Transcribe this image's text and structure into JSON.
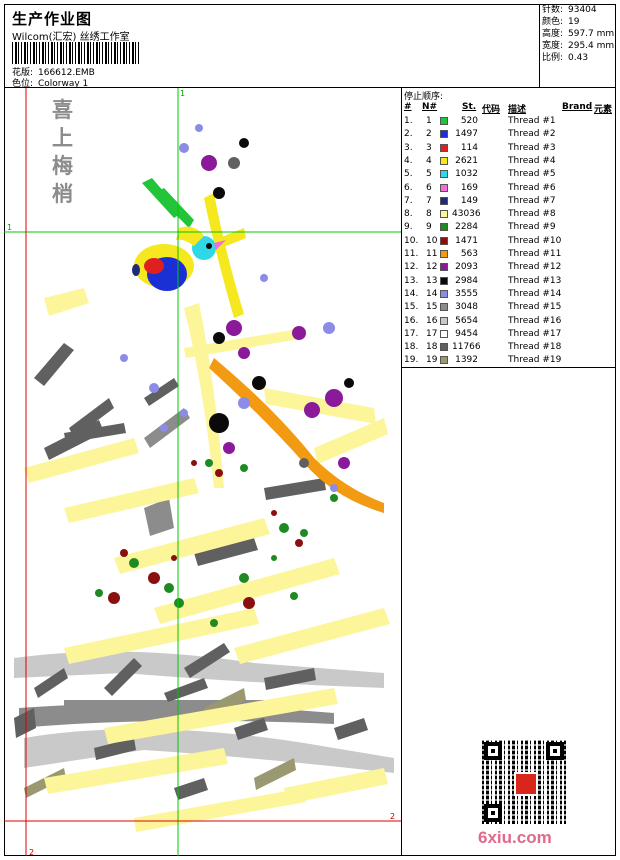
{
  "header": {
    "title": "生产作业图",
    "company": "Wilcom(汇宏) 丝绣工作室",
    "design_label": "花版:",
    "design_file": "166612.EMB",
    "colorway_label": "色位:",
    "colorway": "Colorway 1"
  },
  "stats": {
    "stitches_label": "针数:",
    "stitches": "93404",
    "colors_label": "颜色:",
    "colors": "19",
    "height_label": "高度:",
    "height": "597.7 mm",
    "width_label": "宽度:",
    "width": "295.4 mm",
    "scale_label": "比例:",
    "scale": "0.43"
  },
  "design": {
    "calligraphy": "喜上梅梢",
    "guide_label_top": "1",
    "guide_label_left": "1",
    "guide_label_right": "2",
    "guide_label_bottom": "2"
  },
  "legend": {
    "title": "停止顺序:",
    "headers": {
      "num": "#",
      "n": "N#",
      "st": "St.",
      "code": "代码",
      "desc": "描述",
      "brand": "Brand",
      "element": "元素"
    },
    "rows": [
      {
        "num": "1.",
        "n": "1",
        "st": "520",
        "color": "#22c43a",
        "desc": "Thread #1"
      },
      {
        "num": "2.",
        "n": "2",
        "st": "1497",
        "color": "#1a2fd4",
        "desc": "Thread #2"
      },
      {
        "num": "3.",
        "n": "3",
        "st": "114",
        "color": "#e02020",
        "desc": "Thread #3"
      },
      {
        "num": "4.",
        "n": "4",
        "st": "2621",
        "color": "#f5e81e",
        "desc": "Thread #4"
      },
      {
        "num": "5.",
        "n": "5",
        "st": "1032",
        "color": "#2ed8e6",
        "desc": "Thread #5"
      },
      {
        "num": "6.",
        "n": "6",
        "st": "169",
        "color": "#f070d8",
        "desc": "Thread #6"
      },
      {
        "num": "7.",
        "n": "7",
        "st": "149",
        "color": "#1e2a7a",
        "desc": "Thread #7"
      },
      {
        "num": "8.",
        "n": "8",
        "st": "43036",
        "color": "#fdf59a",
        "desc": "Thread #8"
      },
      {
        "num": "9.",
        "n": "9",
        "st": "2284",
        "color": "#1f8a22",
        "desc": "Thread #9"
      },
      {
        "num": "10.",
        "n": "10",
        "st": "1471",
        "color": "#8a0f0f",
        "desc": "Thread #10"
      },
      {
        "num": "11.",
        "n": "11",
        "st": "563",
        "color": "#f29a12",
        "desc": "Thread #11"
      },
      {
        "num": "12.",
        "n": "12",
        "st": "2093",
        "color": "#8a1a9a",
        "desc": "Thread #12"
      },
      {
        "num": "13.",
        "n": "13",
        "st": "2984",
        "color": "#0a0a0a",
        "desc": "Thread #13"
      },
      {
        "num": "14.",
        "n": "14",
        "st": "3555",
        "color": "#8c8ce6",
        "desc": "Thread #14"
      },
      {
        "num": "15.",
        "n": "15",
        "st": "3048",
        "color": "#8c8c8c",
        "desc": "Thread #15"
      },
      {
        "num": "16.",
        "n": "16",
        "st": "5654",
        "color": "#c9c9c9",
        "desc": "Thread #16"
      },
      {
        "num": "17.",
        "n": "17",
        "st": "9454",
        "color": "#ffffff",
        "desc": "Thread #17"
      },
      {
        "num": "18.",
        "n": "18",
        "st": "11766",
        "color": "#606060",
        "desc": "Thread #18"
      },
      {
        "num": "19.",
        "n": "19",
        "st": "1392",
        "color": "#9a9870",
        "desc": "Thread #19"
      }
    ]
  },
  "watermark": "6xiu.com",
  "colors": {
    "guide_green": "#00c800",
    "guide_red": "#e00000"
  }
}
